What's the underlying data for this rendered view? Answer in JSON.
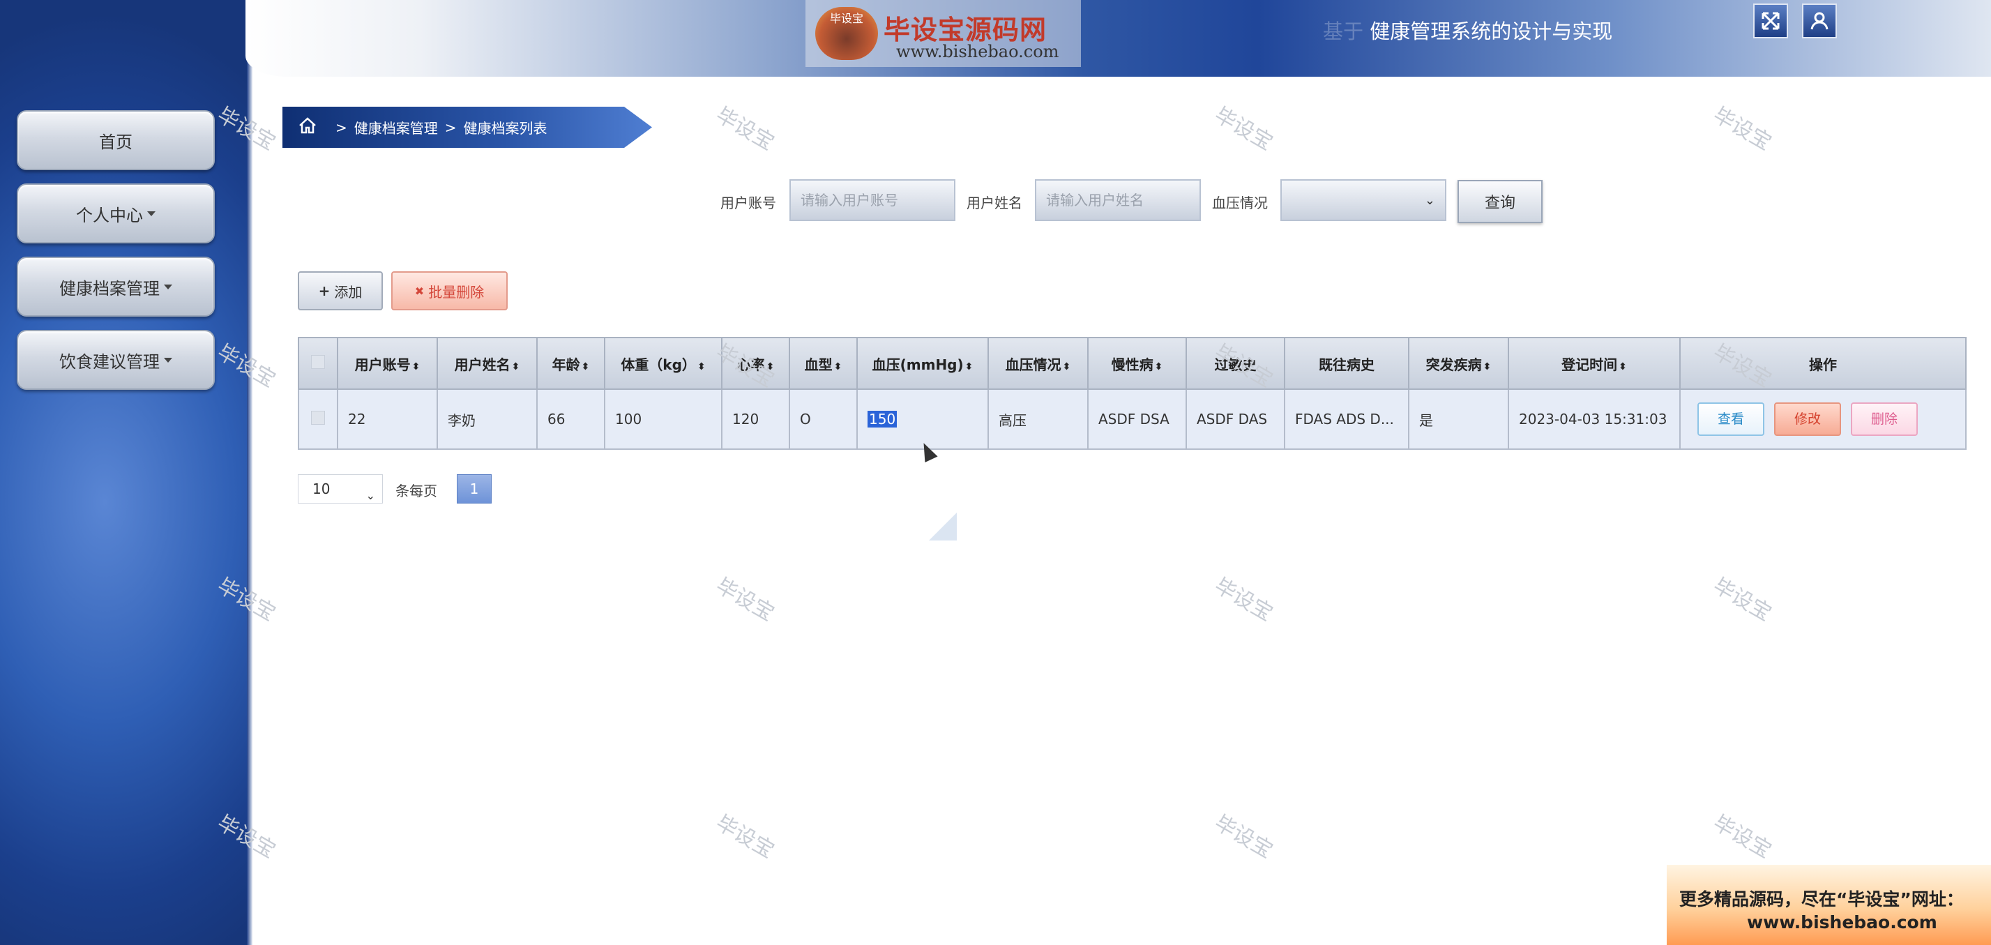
{
  "header": {
    "title": "健康管理系统的设计与实现",
    "title_prefix": "基于",
    "logo_badge": "毕设宝",
    "logo_text": "毕设宝源码网",
    "logo_url": "www.bishebao.com",
    "fullscreen_icon": "expand-icon",
    "user_icon": "user-icon"
  },
  "sidebar": {
    "items": [
      {
        "label": "首页",
        "has_caret": false
      },
      {
        "label": "个人中心",
        "has_caret": true
      },
      {
        "label": "健康档案管理",
        "has_caret": true
      },
      {
        "label": "饮食建议管理",
        "has_caret": true
      }
    ]
  },
  "breadcrumb": {
    "home_icon": "home-icon",
    "sep": ">",
    "level1": "健康档案管理",
    "level2": "健康档案列表"
  },
  "search": {
    "account_label": "用户账号",
    "account_placeholder": "请输入用户账号",
    "name_label": "用户姓名",
    "name_placeholder": "请输入用户姓名",
    "bp_label": "血压情况",
    "bp_value": "",
    "query_label": "查询"
  },
  "actions": {
    "add_icon": "+",
    "add_label": "添加",
    "batch_delete_icon": "✖",
    "batch_delete_label": "批量删除"
  },
  "table": {
    "columns": [
      "用户账号",
      "用户姓名",
      "年龄",
      "体重（kg）",
      "心率",
      "血型",
      "血压(mmHg)",
      "血压情况",
      "慢性病",
      "过敏史",
      "既往病史",
      "突发疾病",
      "登记时间",
      "操作"
    ],
    "sortable": [
      true,
      true,
      true,
      true,
      true,
      true,
      true,
      true,
      true,
      false,
      false,
      true,
      true,
      false
    ],
    "rows": [
      {
        "account": "22",
        "name": "李奶",
        "age": "66",
        "weight": "100",
        "heart_rate": "120",
        "blood_type": "O",
        "blood_pressure": "150",
        "bp_status": "高压",
        "chronic": "ASDF DSA",
        "allergy": "ASDF DAS",
        "history": "FDAS ADS D...",
        "sudden": "是",
        "registered": "2023-04-03 15:31:03",
        "view_label": "查看",
        "edit_label": "修改",
        "delete_label": "删除"
      }
    ]
  },
  "pagination": {
    "page_size": "10",
    "per_page_label": "条每页",
    "current_page": "1"
  },
  "watermark": "毕设宝",
  "ad": {
    "line1": "更多精品源码，尽在“毕设宝”网址：",
    "line2": "www.bishebao.com"
  },
  "colors": {
    "sidebar_blue": "#2f5fb5",
    "header_blue": "#20469a",
    "breadcrumb": "#0f2f73",
    "delete_red": "#d4473a",
    "view_blue": "#2a8bc8",
    "selection": "#2a63d8"
  }
}
